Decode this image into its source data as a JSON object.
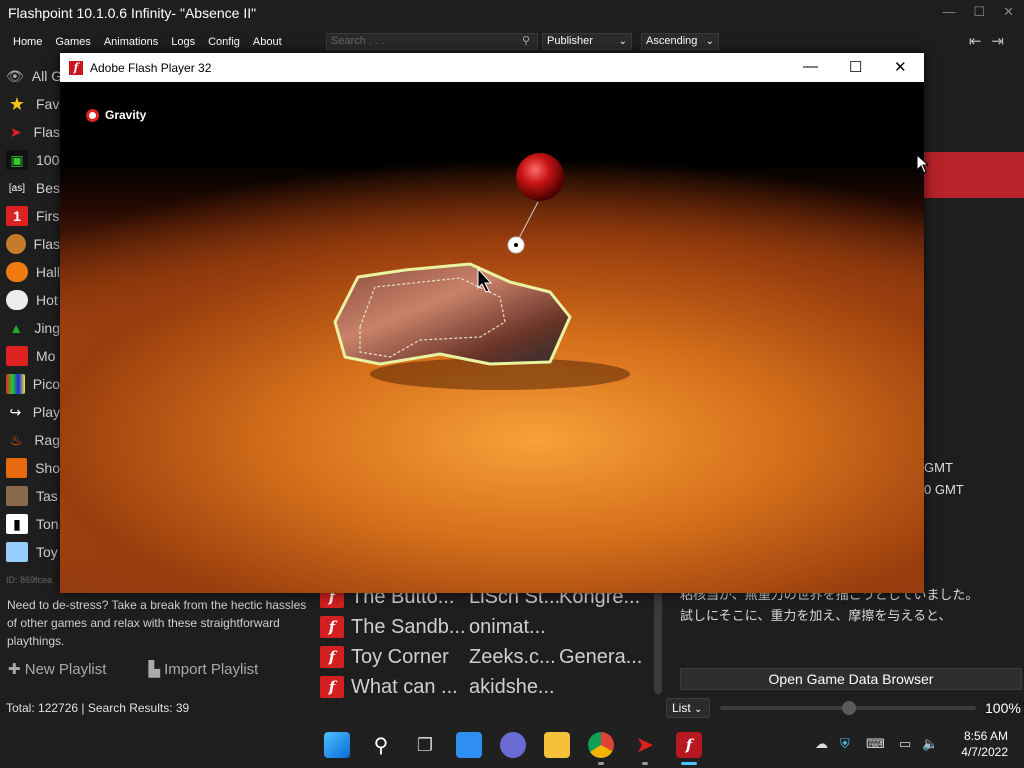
{
  "flashpoint": {
    "title": "Flashpoint 10.1.0.6 Infinity- \"Absence II\"",
    "menu": [
      "Home",
      "Games",
      "Animations",
      "Logs",
      "Config",
      "About"
    ],
    "search_placeholder": "Search . . .",
    "publisher_select": "Publisher",
    "order_select": "Ascending",
    "playlists": [
      {
        "label": "All G",
        "icon": "eye-icon"
      },
      {
        "label": "Fav",
        "icon": "star-icon"
      },
      {
        "label": "Flas",
        "icon": "flashpoint-icon"
      },
      {
        "label": "100",
        "icon": "space-invader-icon"
      },
      {
        "label": "Bes",
        "icon": "as-icon"
      },
      {
        "label": "Firs",
        "icon": "number-one-icon"
      },
      {
        "label": "Flas",
        "icon": "burger-icon"
      },
      {
        "label": "Hall",
        "icon": "pumpkin-icon"
      },
      {
        "label": "Hot",
        "icon": "face-icon"
      },
      {
        "label": "Jing",
        "icon": "tree-icon"
      },
      {
        "label": "Mo",
        "icon": "logo-icon"
      },
      {
        "label": "Pico",
        "icon": "pixels-icon"
      },
      {
        "label": "Play",
        "icon": "share-icon"
      },
      {
        "label": "Rag",
        "icon": "flame-icon"
      },
      {
        "label": "Sho",
        "icon": "waveform-icon"
      },
      {
        "label": "Tas",
        "icon": "character-icon"
      },
      {
        "label": "Ton",
        "icon": "figure-icon"
      },
      {
        "label": "Toy",
        "icon": "blocks-icon"
      }
    ],
    "playlist_id": "ID: 869fcea",
    "description": "Need to de-stress? Take a break from the hectic hassles of other games and relax with these straightforward playthings.",
    "new_playlist": "New Playlist",
    "import_playlist": "Import Playlist",
    "status": "Total: 122726  |  Search Results: 39",
    "games": [
      {
        "title": "The Butto...",
        "developer": "LiSch St...",
        "publisher": "Kongre..."
      },
      {
        "title": "The Sandb...",
        "developer": "onimat...",
        "publisher": ""
      },
      {
        "title": "Toy Corner",
        "developer": "Zeeks.c...",
        "publisher": "Genera..."
      },
      {
        "title": "What can ...",
        "developer": "akidshe...",
        "publisher": ""
      }
    ],
    "date_line_1": "GMT",
    "date_line_2": "0 GMT",
    "jp_line_1": "粘核当が、無重力の世界を描こうとしていました。",
    "jp_line_2": "試しにそこに、重力を加え、摩擦を与えると、",
    "open_browser": "Open Game Data Browser",
    "view_mode": "List",
    "zoom": "100%"
  },
  "flash_player": {
    "title": "Adobe Flash Player 32",
    "gravity_label": "Gravity"
  },
  "taskbar": {
    "time": "8:56 AM",
    "date": "4/7/2022"
  },
  "colors": {
    "flash_red": "#d42020",
    "panel_red": "#b8232a",
    "accent_blue": "#4cc2ff"
  }
}
